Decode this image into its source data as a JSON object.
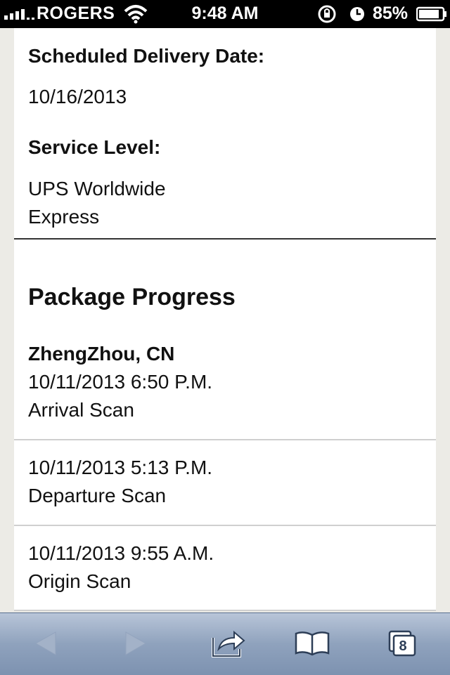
{
  "status_bar": {
    "carrier": "ROGERS",
    "time": "9:48 AM",
    "battery_percent": "85%"
  },
  "delivery": {
    "scheduled_label": "Scheduled Delivery Date:",
    "scheduled_value": "10/16/2013",
    "service_label": "Service Level:",
    "service_line1": "UPS Worldwide",
    "service_line2": "Express"
  },
  "progress": {
    "title": "Package Progress",
    "events": [
      {
        "location": "ZhengZhou, CN",
        "datetime": "10/11/2013 6:50 P.M.",
        "activity": "Arrival Scan"
      },
      {
        "datetime": "10/11/2013 5:13 P.M.",
        "activity": "Departure Scan"
      },
      {
        "datetime": "10/11/2013 9:55 A.M.",
        "activity": "Origin Scan"
      }
    ]
  },
  "toolbar": {
    "tabs_count": "8",
    "icons": [
      "back-icon",
      "forward-icon",
      "share-icon",
      "bookmarks-icon",
      "tabs-icon"
    ]
  },
  "colors": {
    "toolbar": "#8fa2bd",
    "content_bg": "#ffffff",
    "page_bg": "#ecebe6"
  }
}
